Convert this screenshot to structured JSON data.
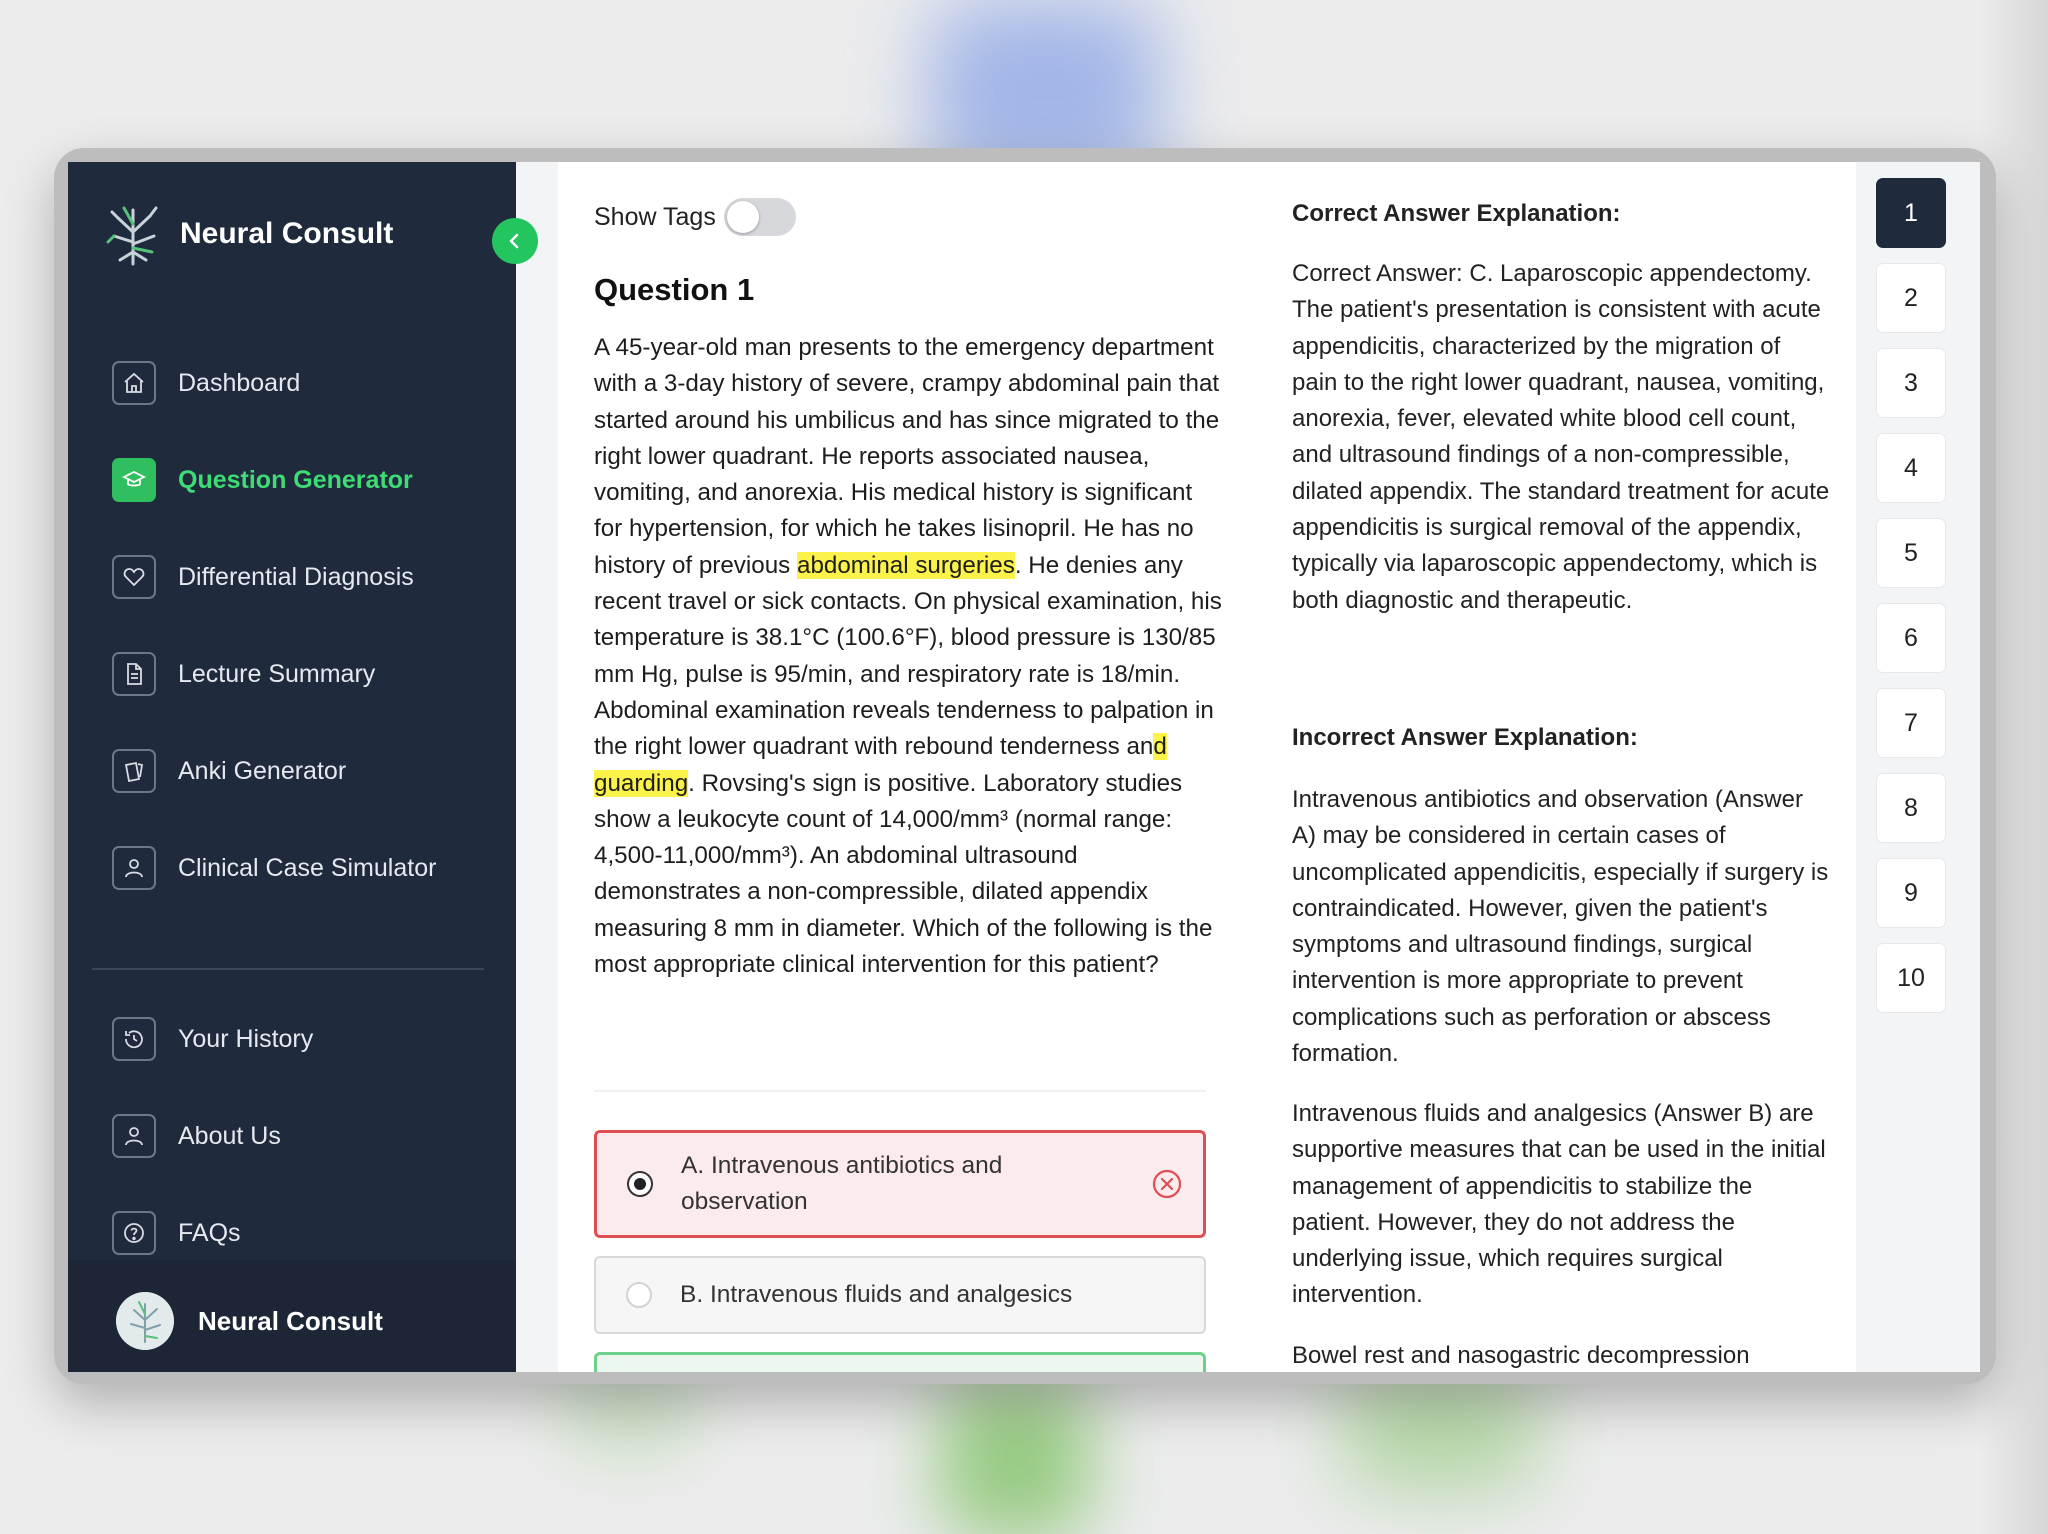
{
  "app": {
    "title": "Neural Consult",
    "collapse_icon": "chevron-left-icon",
    "accent": "#22c55e",
    "sidebar_bg": "#1f2a3c"
  },
  "nav": {
    "items": [
      {
        "label": "Dashboard",
        "icon": "home-icon",
        "active": false
      },
      {
        "label": "Question Generator",
        "icon": "graduation-cap-icon",
        "active": true
      },
      {
        "label": "Differential Diagnosis",
        "icon": "heart-icon",
        "active": false
      },
      {
        "label": "Lecture Summary",
        "icon": "document-icon",
        "active": false
      },
      {
        "label": "Anki Generator",
        "icon": "cards-icon",
        "active": false
      },
      {
        "label": "Clinical Case Simulator",
        "icon": "user-case-icon",
        "active": false
      }
    ],
    "secondary": [
      {
        "label": "Your History",
        "icon": "history-icon"
      },
      {
        "label": "About Us",
        "icon": "users-icon"
      },
      {
        "label": "FAQs",
        "icon": "question-circle-icon"
      }
    ],
    "footer_name": "Neural Consult"
  },
  "question": {
    "show_tags_label": "Show Tags",
    "show_tags_on": false,
    "title": "Question 1",
    "body_parts": [
      "A 45-year-old man presents to the emergency department with a 3-day history of severe, crampy abdominal pain that started around his umbilicus and has since migrated to the right lower quadrant. He reports associated nausea, vomiting, and anorexia. His medical history is significant for hypertension, for which he takes lisinopril. He has no history of previous ",
      "abdominal surgeries",
      ". He denies any recent travel or sick contacts. On physical examination, his temperature is 38.1°C (100.6°F), blood pressure is 130/85 mm Hg, pulse is 95/min, and respiratory rate is 18/min. Abdominal examination reveals tenderness to palpation in the right lower quadrant with rebound tenderness an",
      "d guarding",
      ". Rovsing's sign is positive. Laboratory studies show a leukocyte count of 14,000/mm³ (normal range: 4,500-11,000/mm³). An abdominal ultrasound demonstrates a non-compressible, dilated appendix measuring 8 mm in diameter. Which of the following is the most appropriate clinical intervention for this patient?"
    ],
    "options": [
      {
        "label": "A. Intravenous antibiotics and observation",
        "selected": true,
        "status": "incorrect"
      },
      {
        "label": "B. Intravenous fluids and analgesics",
        "selected": false,
        "status": "neutral"
      },
      {
        "label": "",
        "selected": false,
        "status": "correct"
      }
    ]
  },
  "explanation": {
    "correct_heading": "Correct Answer Explanation:",
    "correct_text": "Correct Answer: C. Laparoscopic appendectomy. The patient's presentation is consistent with acute appendicitis, characterized by the migration of pain to the right lower quadrant, nausea, vomiting, anorexia, fever, elevated white blood cell count, and ultrasound findings of a non-compressible, dilated appendix. The standard treatment for acute appendicitis is surgical removal of the appendix, typically via laparoscopic appendectomy, which is both diagnostic and therapeutic.",
    "incorrect_heading": "Incorrect Answer Explanation:",
    "incorrect_a": "Intravenous antibiotics and observation (Answer A) may be considered in certain cases of uncomplicated appendicitis, especially if surgery is contraindicated. However, given the patient's symptoms and ultrasound findings, surgical intervention is more appropriate to prevent complications such as perforation or abscess formation.",
    "incorrect_b": "Intravenous fluids and analgesics (Answer B) are supportive measures that can be used in the initial management of appendicitis to stabilize the patient. However, they do not address the underlying issue, which requires surgical intervention.",
    "incorrect_c_start": "Bowel rest and nasogastric decompression"
  },
  "question_numbers": [
    "1",
    "2",
    "3",
    "4",
    "5",
    "6",
    "7",
    "8",
    "9",
    "10"
  ],
  "active_question": "1"
}
